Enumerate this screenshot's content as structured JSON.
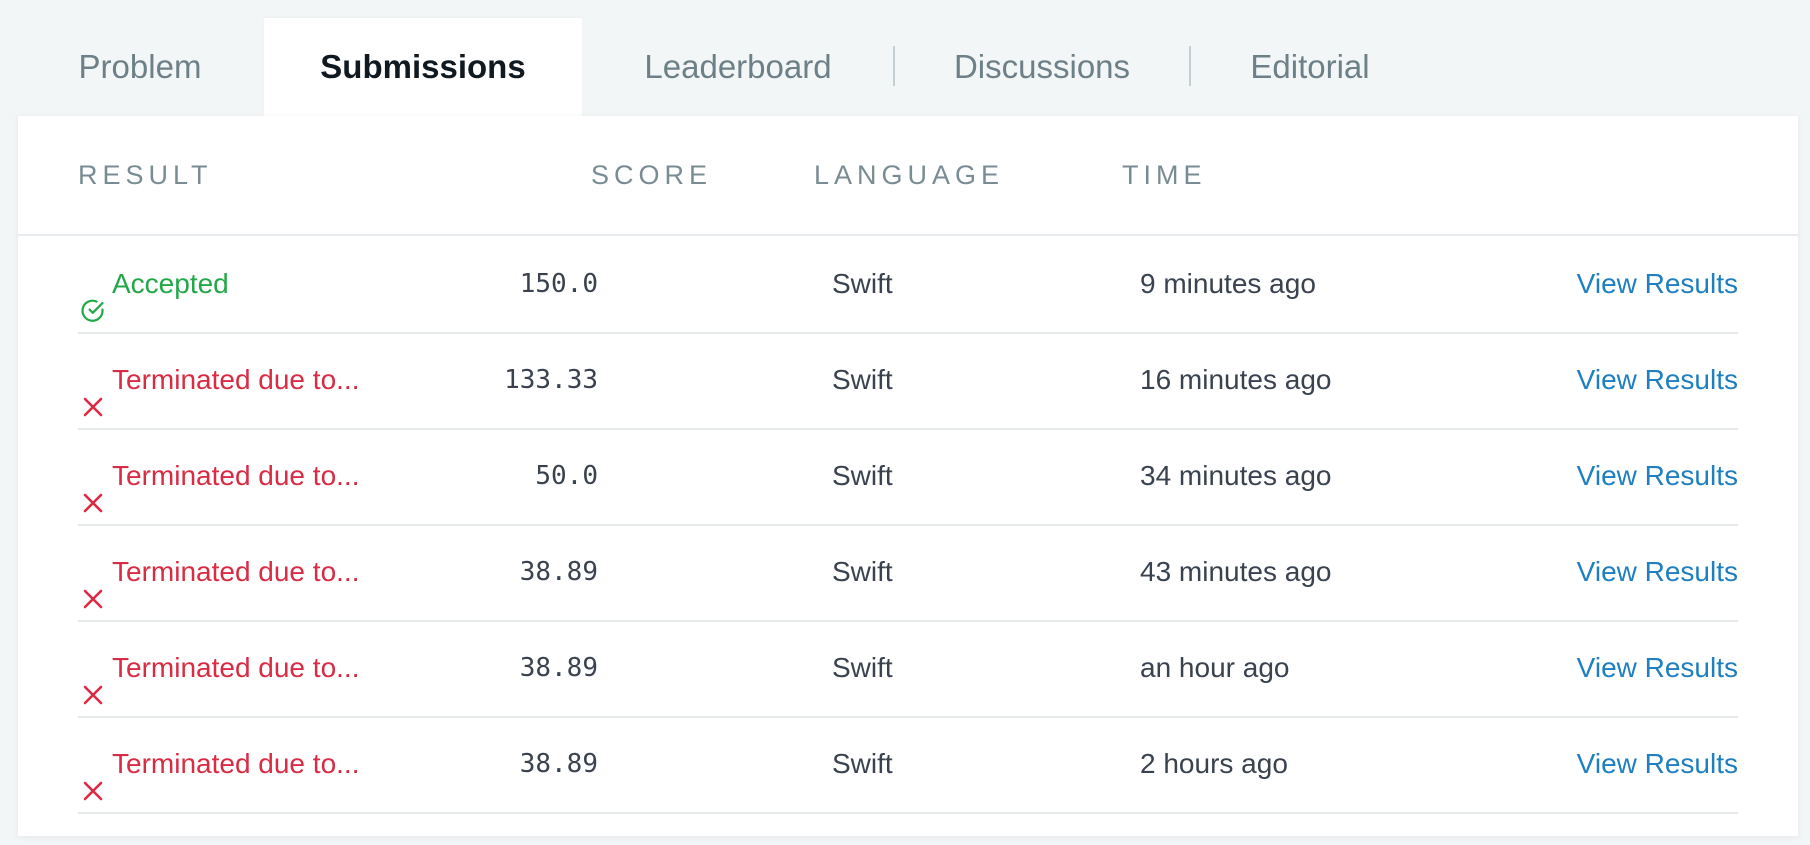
{
  "tabs": [
    {
      "label": "Problem",
      "active": false
    },
    {
      "label": "Submissions",
      "active": true
    },
    {
      "label": "Leaderboard",
      "active": false
    },
    {
      "label": "Discussions",
      "active": false
    },
    {
      "label": "Editorial",
      "active": false
    }
  ],
  "table": {
    "headers": {
      "result": "RESULT",
      "score": "SCORE",
      "language": "LANGUAGE",
      "time": "TIME"
    },
    "rows": [
      {
        "status": "accepted",
        "result": "Accepted",
        "score": "150.0",
        "language": "Swift",
        "time": "9 minutes ago",
        "action": "View Results"
      },
      {
        "status": "failed",
        "result": "Terminated due to...",
        "score": "133.33",
        "language": "Swift",
        "time": "16 minutes ago",
        "action": "View Results"
      },
      {
        "status": "failed",
        "result": "Terminated due to...",
        "score": "50.0",
        "language": "Swift",
        "time": "34 minutes ago",
        "action": "View Results"
      },
      {
        "status": "failed",
        "result": "Terminated due to...",
        "score": "38.89",
        "language": "Swift",
        "time": "43 minutes ago",
        "action": "View Results"
      },
      {
        "status": "failed",
        "result": "Terminated due to...",
        "score": "38.89",
        "language": "Swift",
        "time": "an hour ago",
        "action": "View Results"
      },
      {
        "status": "failed",
        "result": "Terminated due to...",
        "score": "38.89",
        "language": "Swift",
        "time": "2 hours ago",
        "action": "View Results"
      }
    ]
  },
  "icons": {
    "accepted": "check-circle-icon",
    "failed": "x-icon"
  },
  "colors": {
    "accepted": "#22a849",
    "failed": "#d92b44",
    "link": "#1f7fc0"
  }
}
